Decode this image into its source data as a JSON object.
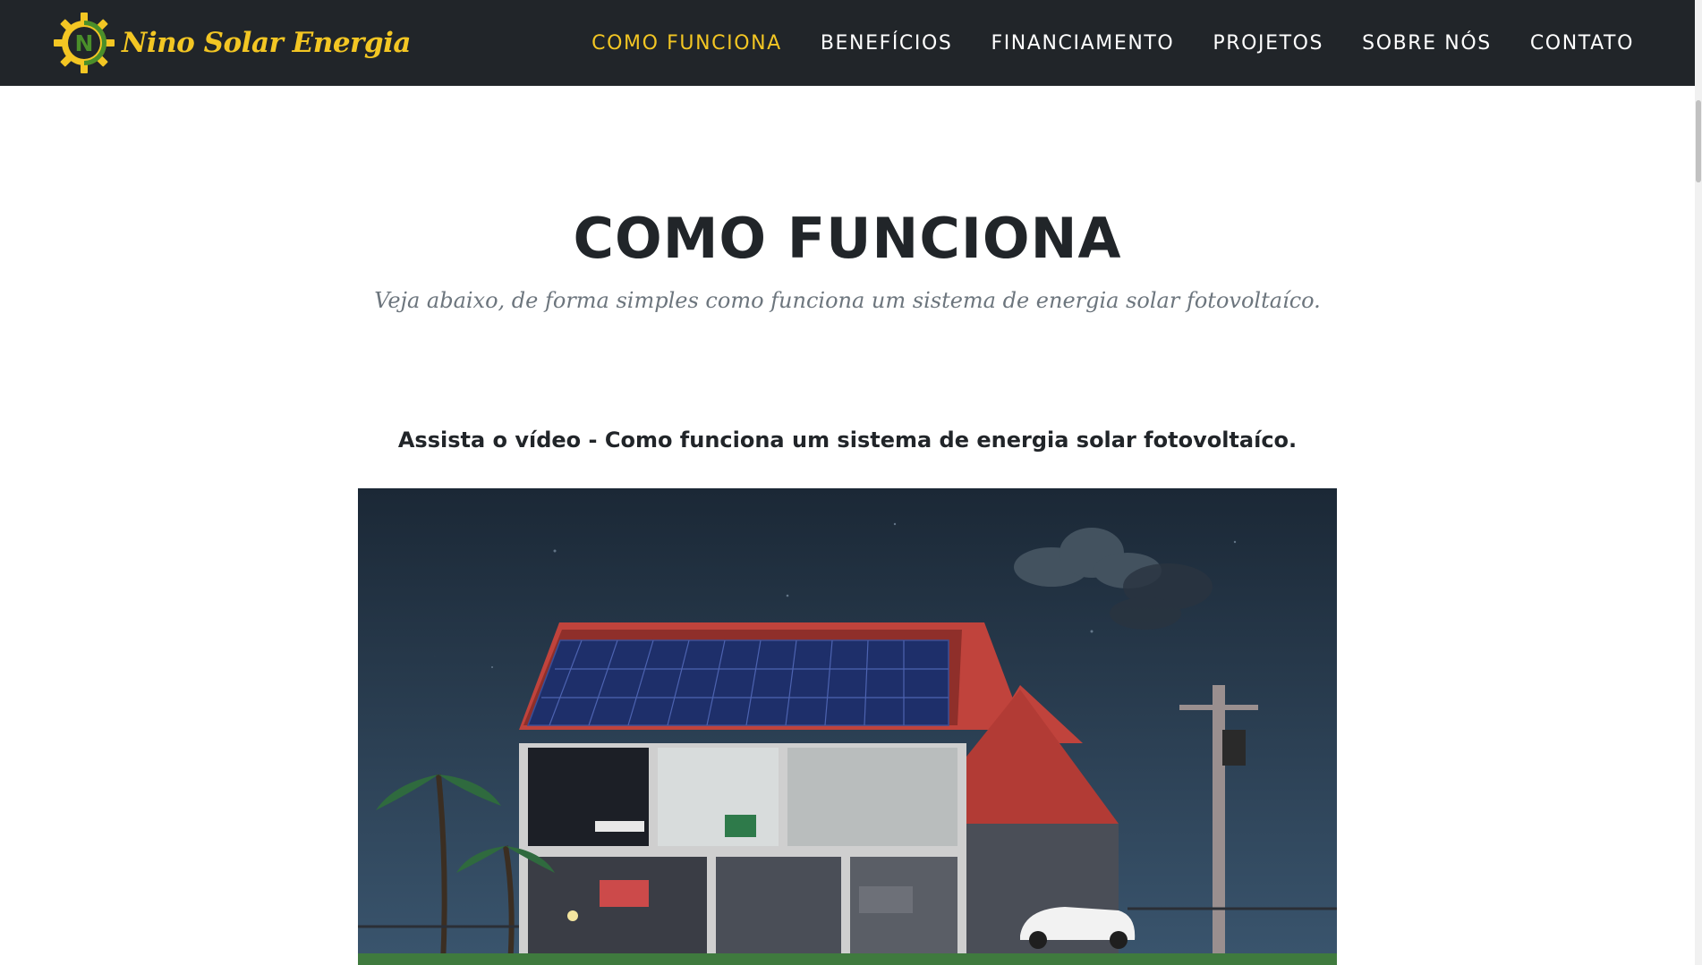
{
  "brand": {
    "name": "Nino Solar Energia",
    "logo_letter": "N"
  },
  "nav": {
    "items": [
      {
        "label": "COMO FUNCIONA",
        "active": true
      },
      {
        "label": "BENEFÍCIOS",
        "active": false
      },
      {
        "label": "FINANCIAMENTO",
        "active": false
      },
      {
        "label": "PROJETOS",
        "active": false
      },
      {
        "label": "SOBRE NÓS",
        "active": false
      },
      {
        "label": "CONTATO",
        "active": false
      }
    ]
  },
  "section": {
    "title": "COMO FUNCIONA",
    "subtitle": "Veja abaixo, de forma simples como funciona um sistema de energia solar fotovoltaíco."
  },
  "video": {
    "heading": "Assista o vídeo - Como funciona um sistema de energia solar fotovoltaíco."
  },
  "colors": {
    "navbar_bg": "#212529",
    "accent": "#f3c623",
    "logo_green": "#4a8f2a",
    "heading": "#212529",
    "muted": "#6c757d"
  }
}
